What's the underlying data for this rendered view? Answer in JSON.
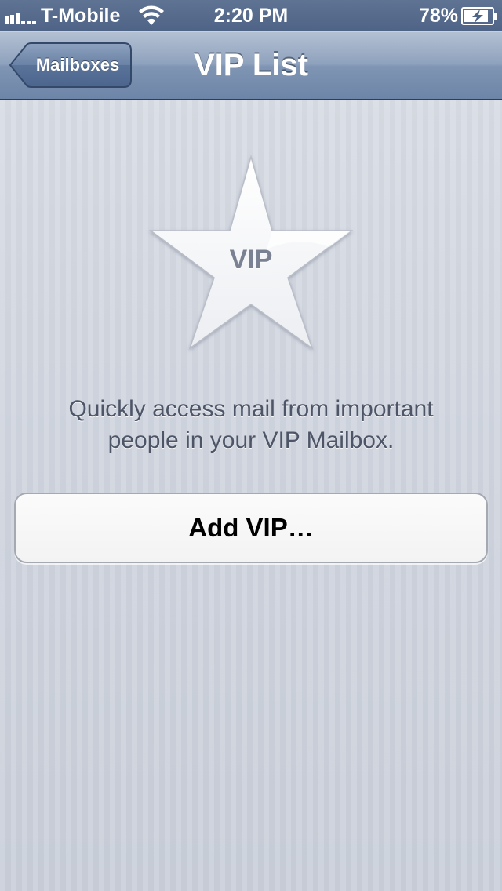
{
  "status_bar": {
    "carrier": "T-Mobile",
    "time": "2:20 PM",
    "battery_percent": "78%",
    "signal_icon": "signal-bars-icon",
    "wifi_icon": "wifi-icon",
    "battery_icon": "battery-charging-icon"
  },
  "nav_bar": {
    "back_label": "Mailboxes",
    "title": "VIP List"
  },
  "hero": {
    "star_icon": "vip-star-icon",
    "star_label": "VIP",
    "description_line1": "Quickly access mail from important",
    "description_line2": "people in your VIP Mailbox."
  },
  "actions": {
    "add_vip_label": "Add VIP…"
  },
  "colors": {
    "nav_bar": "#7f95b3",
    "status_bar": "#4e6486",
    "background": "#cdd2dc",
    "description_text": "#4d5566",
    "star_text": "#7a8192"
  }
}
